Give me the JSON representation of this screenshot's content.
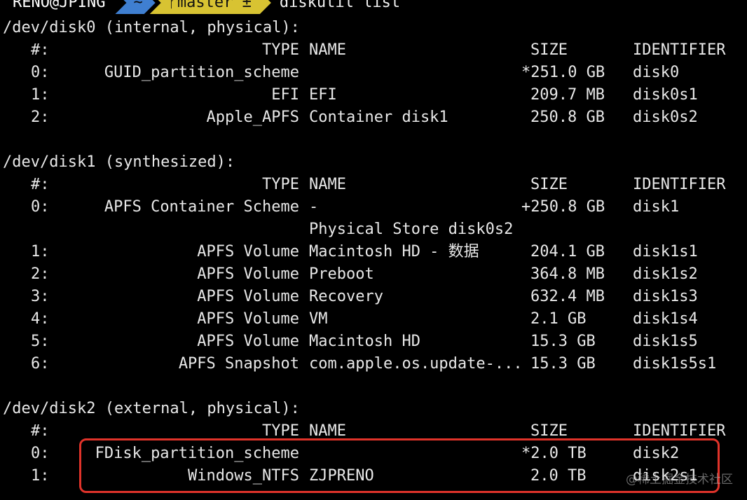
{
  "prompt": {
    "user": "RENO@JPING",
    "dir": "~",
    "branch_icon": "git-branch-icon",
    "branch": "master ±",
    "command": "diskutil list"
  },
  "disks": [
    {
      "header": "/dev/disk0 (internal, physical):",
      "columns": {
        "num": "#:",
        "type": "TYPE",
        "name": "NAME",
        "size": "SIZE",
        "identifier": "IDENTIFIER"
      },
      "rows": [
        {
          "num": "0:",
          "type": "GUID_partition_scheme",
          "name": "",
          "size": "*251.0 GB",
          "identifier": "disk0"
        },
        {
          "num": "1:",
          "type": "EFI",
          "name": "EFI",
          "size": "209.7 MB",
          "identifier": "disk0s1"
        },
        {
          "num": "2:",
          "type": "Apple_APFS",
          "name": "Container disk1",
          "size": "250.8 GB",
          "identifier": "disk0s2"
        }
      ]
    },
    {
      "header": "/dev/disk1 (synthesized):",
      "columns": {
        "num": "#:",
        "type": "TYPE",
        "name": "NAME",
        "size": "SIZE",
        "identifier": "IDENTIFIER"
      },
      "rows": [
        {
          "num": "0:",
          "type": "APFS Container Scheme",
          "name": "-",
          "size": "+250.8 GB",
          "identifier": "disk1"
        },
        {
          "num": "",
          "type": "",
          "name": "Physical Store disk0s2",
          "size": "",
          "identifier": ""
        },
        {
          "num": "1:",
          "type": "APFS Volume",
          "name": "Macintosh HD - 数据",
          "size": "204.1 GB",
          "identifier": "disk1s1"
        },
        {
          "num": "2:",
          "type": "APFS Volume",
          "name": "Preboot",
          "size": "364.8 MB",
          "identifier": "disk1s2"
        },
        {
          "num": "3:",
          "type": "APFS Volume",
          "name": "Recovery",
          "size": "632.4 MB",
          "identifier": "disk1s3"
        },
        {
          "num": "4:",
          "type": "APFS Volume",
          "name": "VM",
          "size": "2.1 GB",
          "identifier": "disk1s4"
        },
        {
          "num": "5:",
          "type": "APFS Volume",
          "name": "Macintosh HD",
          "size": "15.3 GB",
          "identifier": "disk1s5"
        },
        {
          "num": "6:",
          "type": "APFS Snapshot",
          "name": "com.apple.os.update-...",
          "size": "15.3 GB",
          "identifier": "disk1s5s1"
        }
      ]
    },
    {
      "header": "/dev/disk2 (external, physical):",
      "columns": {
        "num": "#:",
        "type": "TYPE",
        "name": "NAME",
        "size": "SIZE",
        "identifier": "IDENTIFIER"
      },
      "rows": [
        {
          "num": "0:",
          "type": "FDisk_partition_scheme",
          "name": "",
          "size": "*2.0 TB",
          "identifier": "disk2"
        },
        {
          "num": "1:",
          "type": "Windows_NTFS",
          "name": "ZJPRENO",
          "size": "2.0 TB",
          "identifier": "disk2s1"
        }
      ]
    }
  ],
  "watermark": "@稀土掘金技术社区",
  "colors": {
    "background": "#000000",
    "text": "#e8e8e8",
    "prompt_dir_bg": "#3f7fd1",
    "prompt_git_bg": "#d8c332",
    "highlight_border": "#e0332a"
  }
}
